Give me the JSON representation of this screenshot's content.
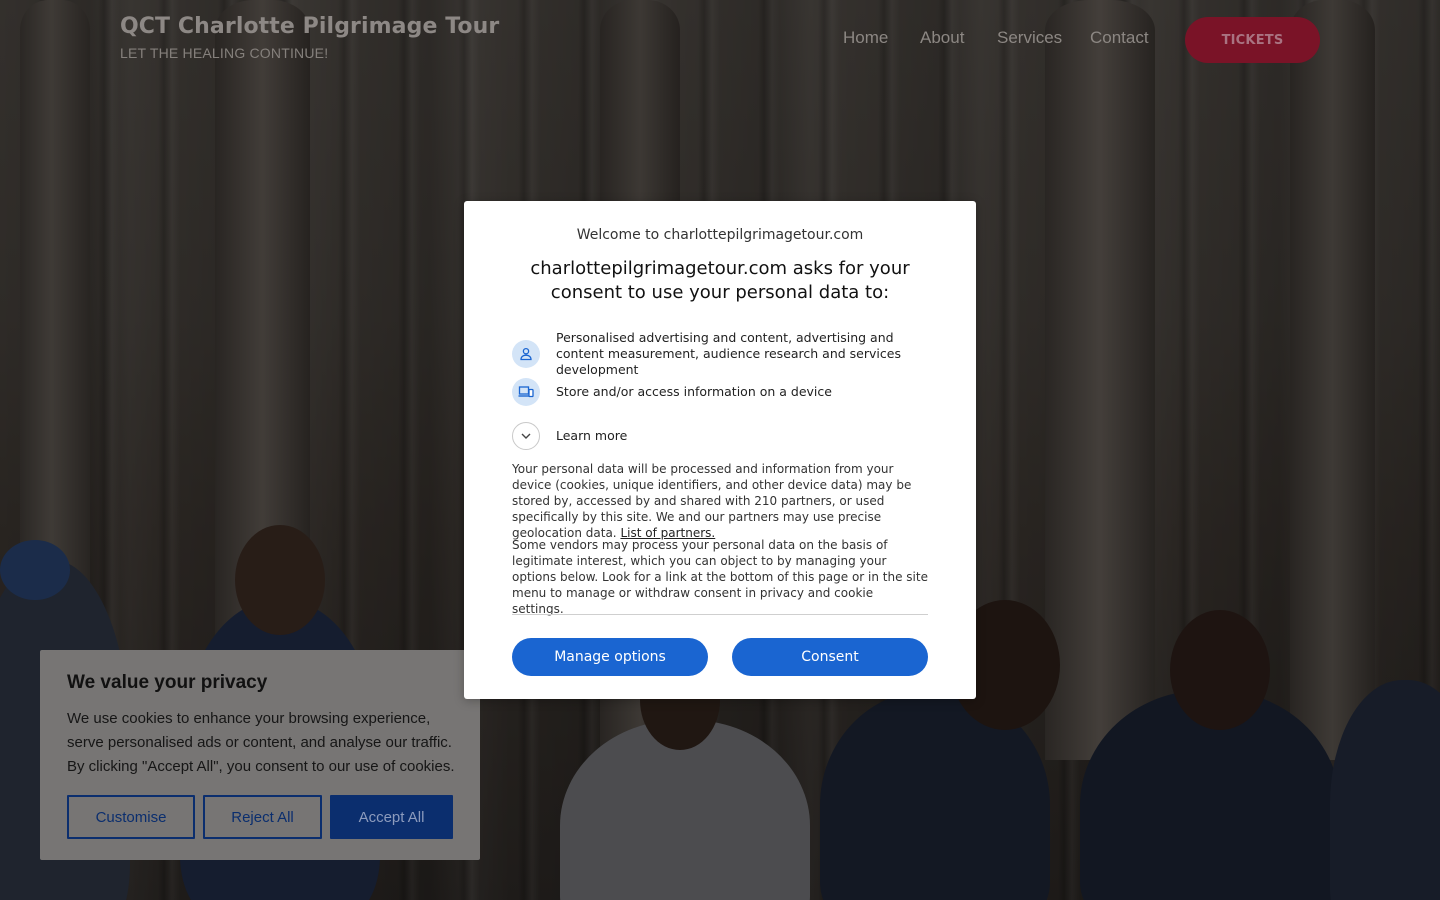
{
  "site": {
    "title": "QCT Charlotte Pilgrimage Tour",
    "tagline": "LET THE HEALING CONTINUE!"
  },
  "nav": {
    "items": [
      {
        "label": "Home"
      },
      {
        "label": "About"
      },
      {
        "label": "Services"
      },
      {
        "label": "Contact"
      }
    ],
    "tickets_label": "TICKETS"
  },
  "colors": {
    "tickets_bg": "#7a1327",
    "modal_button": "#1a65d1",
    "cookie_accent": "#0b2e6e"
  },
  "consent_modal": {
    "welcome": "Welcome to charlottepilgrimagetour.com",
    "heading": "charlottepilgrimagetour.com asks for your consent to use your personal data to:",
    "purposes": [
      {
        "icon": "person-icon",
        "label": "Personalised advertising and content, advertising and content measurement, audience research and services development"
      },
      {
        "icon": "devices-icon",
        "label": "Store and/or access information on a device"
      }
    ],
    "learn_more": {
      "icon": "chevron-down-icon",
      "label": "Learn more"
    },
    "paragraph1": "Your personal data will be processed and information from your device (cookies, unique identifiers, and other device data) may be stored by, accessed by and shared with 210 partners, or used specifically by this site. We and our partners may use precise geolocation data.",
    "partners_link": "List of partners.",
    "paragraph2": "Some vendors may process your personal data on the basis of legitimate interest, which you can object to by managing your options below. Look for a link at the bottom of this page or in the site menu to manage or withdraw consent in privacy and cookie settings.",
    "manage_label": "Manage options",
    "consent_label": "Consent"
  },
  "cookie_banner": {
    "title": "We value your privacy",
    "text": "We use cookies to enhance your browsing experience, serve personalised ads or content, and analyse our traffic. By clicking \"Accept All\", you consent to our use of cookies.",
    "customise_label": "Customise",
    "reject_label": "Reject All",
    "accept_label": "Accept All"
  }
}
